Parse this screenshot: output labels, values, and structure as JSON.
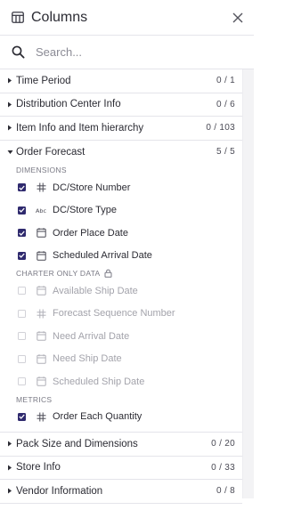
{
  "header": {
    "title": "Columns"
  },
  "search": {
    "placeholder": "Search..."
  },
  "groups_top": [
    {
      "label": "Time Period",
      "count": "0 / 1"
    },
    {
      "label": "Distribution Center Info",
      "count": "0 / 6"
    },
    {
      "label": "Item Info and Item hierarchy",
      "count": "0 / 103"
    }
  ],
  "order_forecast": {
    "label": "Order Forecast",
    "count": "5 / 5",
    "dimensions_label": "DIMENSIONS",
    "dimensions": [
      {
        "label": "DC/Store Number",
        "icon": "hash-icon"
      },
      {
        "label": "DC/Store Type",
        "icon": "text-type-icon"
      },
      {
        "label": "Order Place Date",
        "icon": "calendar-icon"
      },
      {
        "label": "Scheduled Arrival Date",
        "icon": "calendar-icon"
      }
    ],
    "charter_label": "CHARTER ONLY DATA",
    "charter": [
      {
        "label": "Available Ship Date",
        "icon": "calendar-icon"
      },
      {
        "label": "Forecast Sequence Number",
        "icon": "hash-icon"
      },
      {
        "label": "Need Arrival Date",
        "icon": "calendar-icon"
      },
      {
        "label": "Need Ship Date",
        "icon": "calendar-icon"
      },
      {
        "label": "Scheduled Ship Date",
        "icon": "calendar-icon"
      }
    ],
    "metrics_label": "METRICS",
    "metrics": [
      {
        "label": "Order Each Quantity",
        "icon": "hash-icon"
      }
    ]
  },
  "groups_bottom": [
    {
      "label": "Pack Size and Dimensions",
      "count": "0 / 20"
    },
    {
      "label": "Store Info",
      "count": "0 / 33"
    },
    {
      "label": "Vendor Information",
      "count": "0 / 8"
    }
  ],
  "colors": {
    "checkbox_checked": "#2f2a6e",
    "text": "#2b2b33",
    "muted": "#a3a3ab"
  }
}
